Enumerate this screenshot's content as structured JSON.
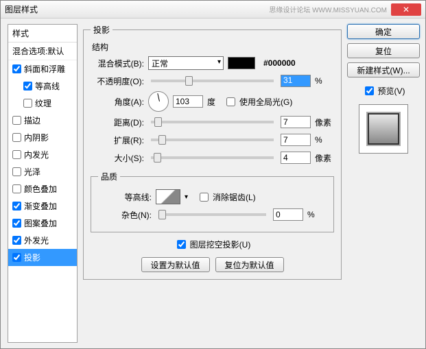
{
  "title": "图层样式",
  "watermark": "思缘设计论坛  WWW.MISSYUAN.COM",
  "close_icon": "✕",
  "styles": {
    "header": "样式",
    "blend_default": "混合选项:默认",
    "items": [
      {
        "label": "斜面和浮雕",
        "checked": true,
        "indent": false
      },
      {
        "label": "等高线",
        "checked": true,
        "indent": true
      },
      {
        "label": "纹理",
        "checked": false,
        "indent": true
      },
      {
        "label": "描边",
        "checked": false,
        "indent": false
      },
      {
        "label": "内阴影",
        "checked": false,
        "indent": false
      },
      {
        "label": "内发光",
        "checked": false,
        "indent": false
      },
      {
        "label": "光泽",
        "checked": false,
        "indent": false
      },
      {
        "label": "颜色叠加",
        "checked": false,
        "indent": false
      },
      {
        "label": "渐变叠加",
        "checked": true,
        "indent": false
      },
      {
        "label": "图案叠加",
        "checked": true,
        "indent": false
      },
      {
        "label": "外发光",
        "checked": true,
        "indent": false
      },
      {
        "label": "投影",
        "checked": true,
        "indent": false,
        "selected": true
      }
    ]
  },
  "shadow": {
    "panel_title": "投影",
    "structure": {
      "group_title": "结构",
      "blend_mode_label": "混合模式(B):",
      "blend_mode_value": "正常",
      "color_hex": "#000000",
      "opacity_label": "不透明度(O):",
      "opacity_value": "31",
      "opacity_unit": "%",
      "angle_label": "角度(A):",
      "angle_value": "103",
      "angle_unit": "度",
      "global_light_label": "使用全局光(G)",
      "global_light_checked": false,
      "distance_label": "距离(D):",
      "distance_value": "7",
      "distance_unit": "像素",
      "spread_label": "扩展(R):",
      "spread_value": "7",
      "spread_unit": "%",
      "size_label": "大小(S):",
      "size_value": "4",
      "size_unit": "像素"
    },
    "quality": {
      "group_title": "品质",
      "contour_label": "等高线:",
      "antialias_label": "消除锯齿(L)",
      "antialias_checked": false,
      "noise_label": "杂色(N):",
      "noise_value": "0",
      "noise_unit": "%"
    },
    "knockout_label": "图层挖空投影(U)",
    "knockout_checked": true,
    "make_default_btn": "设置为默认值",
    "reset_default_btn": "复位为默认值"
  },
  "right": {
    "ok": "确定",
    "cancel": "复位",
    "new_style": "新建样式(W)...",
    "preview_label": "预览(V)",
    "preview_checked": true
  }
}
